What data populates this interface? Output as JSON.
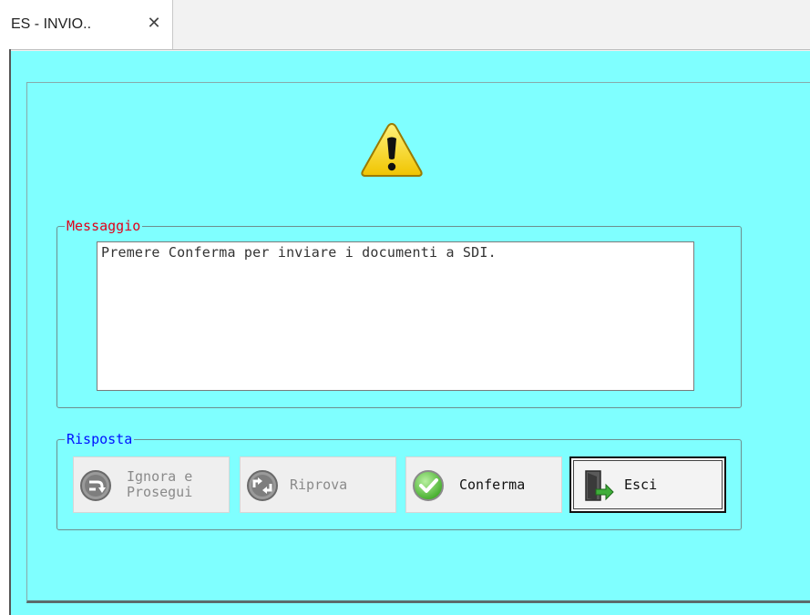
{
  "tab": {
    "title": "ES - INVIO..",
    "close_glyph": "✕"
  },
  "icons": {
    "warning": "warning-triangle-icon",
    "ignore": "skip-arrow-icon",
    "retry": "retry-arrows-icon",
    "confirm": "green-check-icon",
    "exit": "exit-door-icon"
  },
  "message_group": {
    "legend": "Messaggio",
    "text": "Premere Conferma per inviare i documenti a SDI."
  },
  "response_group": {
    "legend": "Risposta",
    "buttons": {
      "ignore_line1": "Ignora e",
      "ignore_line2": "Prosegui",
      "retry": "Riprova",
      "confirm": "Conferma",
      "exit": "Esci"
    }
  },
  "colors": {
    "background": "#7fffff",
    "message_legend": "#e1001a",
    "response_legend": "#0010ff",
    "warning_fill": "#f5d21c",
    "confirm_green": "#4ec12e"
  }
}
